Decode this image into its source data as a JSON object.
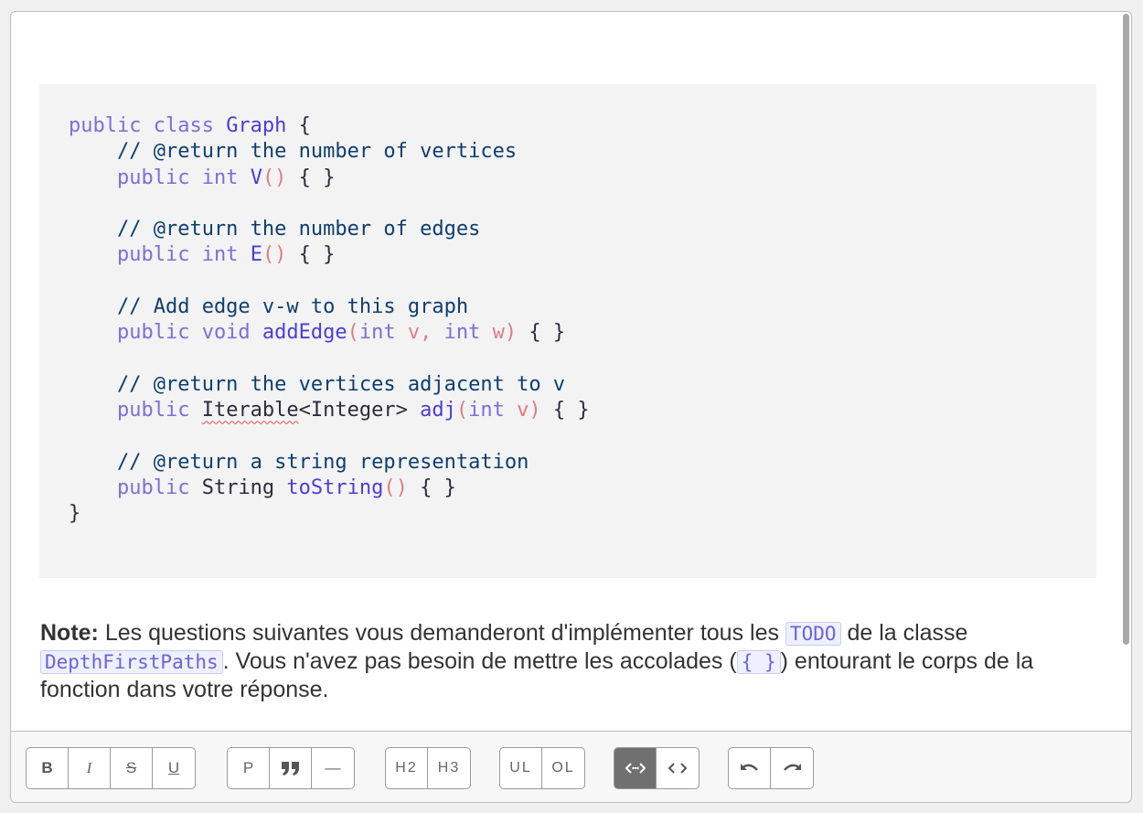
{
  "code": {
    "lines": [
      "public class Graph {",
      "    // @return the number of vertices",
      "    public int V() { }",
      "",
      "    // @return the number of edges",
      "    public int E() { }",
      "",
      "    // Add edge v-w to this graph",
      "    public void addEdge(int v, int w) { }",
      "",
      "    // @return the vertices adjacent to v",
      "    public Iterable<Integer> adj(int v) { }",
      "",
      "    // @return a string representation",
      "    public String toString() { }",
      "}"
    ]
  },
  "note": {
    "label": "Note:",
    "text1": " Les questions suivantes vous demanderont d'implémenter tous les ",
    "code1": "TODO",
    "text2": " de la classe ",
    "code2": "DepthFirstPaths",
    "text3": ". Vous n'avez pas besoin de mettre les accolades (",
    "code3": "{ }",
    "text4": ") entourant le corps de la fonction dans votre réponse."
  },
  "toolbar": {
    "bold": "B",
    "italic": "I",
    "strike": "S",
    "underline": "U",
    "paragraph": "P",
    "quote": "❞",
    "hr": "—",
    "h2": "H2",
    "h3": "H3",
    "ul": "UL",
    "ol": "OL",
    "code_block": "‹·›",
    "code_inline": "‹ ›",
    "undo": "↶",
    "redo": "↷"
  }
}
